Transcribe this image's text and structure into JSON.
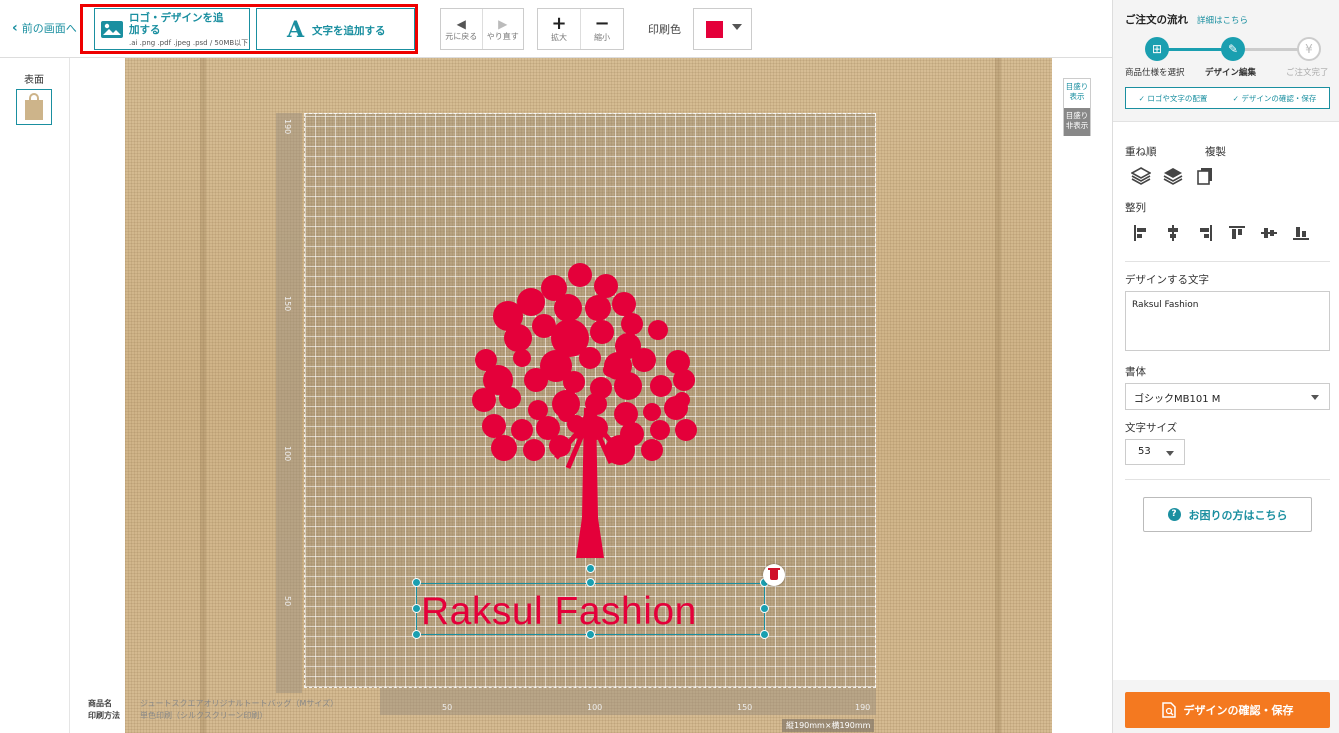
{
  "toolbar": {
    "back_label": "前の画面へ",
    "add_logo_label": "ロゴ・デザインを追加する",
    "add_logo_formats": ".ai .png .pdf .jpeg .psd / 50MB以下",
    "add_text_label": "文字を追加する",
    "undo_label": "元に戻る",
    "redo_label": "やり直す",
    "zoom_in_label": "拡大",
    "zoom_out_label": "縮小",
    "print_color_label": "印刷色",
    "print_color": "#e4003a"
  },
  "sides": {
    "front_label": "表面"
  },
  "canvas": {
    "text": "Raksul Fashion",
    "text_color": "#e4003a",
    "ruler_left": [
      "190",
      "150",
      "100",
      "50"
    ],
    "ruler_bottom": [
      "50",
      "100",
      "150",
      "190"
    ],
    "grid_show_label": "目盛り表示",
    "grid_hide_label": "目盛り非表示",
    "size_label": "縦190mm×横190mm",
    "product_key": "商品名",
    "product_value": "ジュートスクエアオリジナルトートバッグ（Mサイズ）",
    "method_key": "印刷方法",
    "method_value": "単色印刷（シルクスクリーン印刷）"
  },
  "flow": {
    "title": "ご注文の流れ",
    "details_link": "詳細はこちら",
    "steps": [
      {
        "label": "商品仕様を選択"
      },
      {
        "label": "デザイン編集"
      },
      {
        "label": "ご注文完了"
      }
    ],
    "substeps": [
      "✓ ロゴや文字の配置",
      "✓ デザインの確認・保存"
    ]
  },
  "panel": {
    "order_label": "重ね順",
    "duplicate_label": "複製",
    "align_label": "整列",
    "design_text_label": "デザインする文字",
    "design_text_value": "Raksul Fashion",
    "font_label": "書体",
    "font_value": "ゴシックMB101 M",
    "size_label": "文字サイズ",
    "size_value": "53",
    "help_label": "お困りの方はこちら",
    "confirm_label": "デザインの確認・保存"
  }
}
